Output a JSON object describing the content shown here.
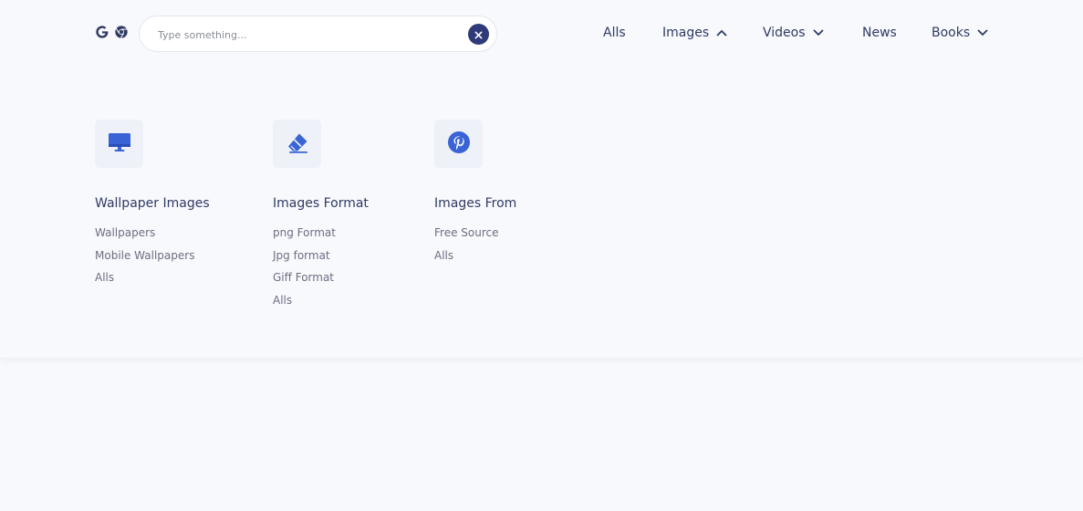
{
  "search": {
    "placeholder": "Type something..."
  },
  "logo_icons": [
    "google-icon",
    "chrome-icon"
  ],
  "nav": {
    "items": [
      {
        "label": "Alls",
        "chevron": null
      },
      {
        "label": "Images",
        "chevron": "chevron-up-icon"
      },
      {
        "label": "Videos",
        "chevron": "chevron-down-icon"
      },
      {
        "label": "News",
        "chevron": null
      },
      {
        "label": "Books",
        "chevron": "chevron-down-icon"
      }
    ]
  },
  "columns": [
    {
      "icon": "monitor-icon",
      "title": "Wallpaper Images",
      "links": [
        "Wallpapers",
        "Mobile Wallpapers",
        "Alls"
      ]
    },
    {
      "icon": "eraser-icon",
      "title": "Images Format",
      "links": [
        "png Format",
        "Jpg format",
        "Giff Format",
        "Alls"
      ]
    },
    {
      "icon": "pinterest-icon",
      "title": "Images From",
      "links": [
        "Free Source",
        "Alls"
      ]
    }
  ],
  "colors": {
    "accent": "#2f3a78",
    "icon_blue": "#3a63d6",
    "background": "#f8f9fd",
    "text_dark": "#2f3a63",
    "text_muted": "#6b6f80"
  }
}
